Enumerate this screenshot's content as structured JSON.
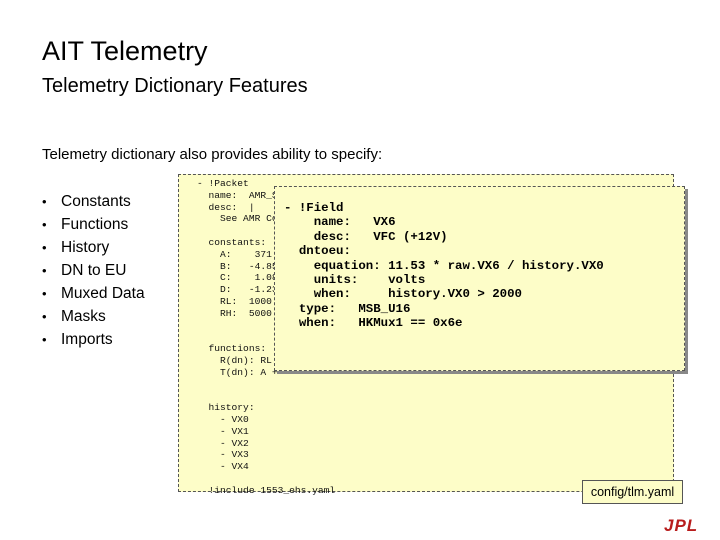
{
  "slide": {
    "title": "AIT Telemetry",
    "subtitle": "Telemetry Dictionary Features",
    "intro": "Telemetry dictionary also provides ability to specify:",
    "bullet_char": "•",
    "bullets": [
      "Constants",
      "Functions",
      "History",
      "DN to EU",
      "Muxed Data",
      "Masks",
      "Imports"
    ]
  },
  "code": {
    "packet_yaml": "- !Packet\n  name:  AMR_St\n  desc:  |\n    See AMR Comm\n\n  constants:\n    A:    371.81\n    B:   -4.850e\n    C:    1.086e\n    D:   -1.239e\n    RL:  1000.0\n    RH:  5000.0\n\n\n  functions:\n    R(dn): RL +\n    T(dn): A +\n\n\n  history:\n    - VX0\n    - VX1\n    - VX2\n    - VX3\n    - VX4\n\n  !include 1553_ehs.yaml",
    "field_yaml": "- !Field\n    name:   VX6\n    desc:   VFC (+12V)\n  dntoeu:\n    equation: 11.53 * raw.VX6 / history.VX0\n    units:    volts\n    when:     history.VX0 > 2000\n  type:   MSB_U16\n  when:   HKMux1 == 0x6e"
  },
  "file_label": "config/tlm.yaml",
  "logo_text": "JPL",
  "colors": {
    "code_background": "#fdfdc8",
    "logo": "#b81c1c"
  }
}
